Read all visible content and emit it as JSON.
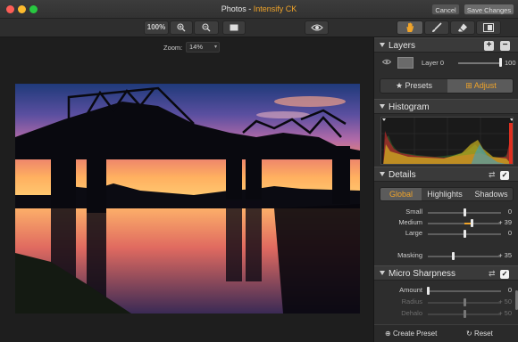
{
  "window": {
    "title_prefix": "Photos - ",
    "title_app": "Intensify CK",
    "cancel_label": "Cancel",
    "save_label": "Save Changes"
  },
  "toolbar": {
    "zoom_value": "100%",
    "icons": [
      "zoom-in-icon",
      "zoom-out-icon",
      "fit-to-screen-icon",
      "preview-eye-icon",
      "hand-tool-icon",
      "brush-tool-icon",
      "eraser-tool-icon",
      "mask-icon"
    ]
  },
  "canvas": {
    "zoom_label": "Zoom:",
    "zoom_value": "14%"
  },
  "panel": {
    "layers": {
      "title": "Layers",
      "layer_name": "Layer 0",
      "opacity_value": "100",
      "opacity_fraction": 1.0
    },
    "modes": {
      "presets_label": "Presets",
      "adjust_label": "Adjust",
      "active": "Adjust"
    },
    "histogram": {
      "title": "Histogram"
    },
    "details": {
      "title": "Details",
      "tabs": [
        "Global",
        "Highlights",
        "Shadows"
      ],
      "active_tab": "Global",
      "sliders": [
        {
          "label": "Small",
          "value": "0",
          "fraction": 0.5
        },
        {
          "label": "Medium",
          "value": "+ 39",
          "fraction": 0.6
        },
        {
          "label": "Large",
          "value": "0",
          "fraction": 0.5
        },
        {
          "label": "Masking",
          "value": "+ 35",
          "fraction": 0.35
        }
      ]
    },
    "micro_sharpness": {
      "title": "Micro Sharpness",
      "sliders": [
        {
          "label": "Amount",
          "value": "0",
          "fraction": 0.0
        },
        {
          "label": "Radius",
          "value": "+ 50",
          "fraction": 0.5
        },
        {
          "label": "Dehalo",
          "value": "+ 50",
          "fraction": 0.5
        }
      ]
    },
    "footer": {
      "create_preset_label": "Create Preset",
      "reset_label": "Reset"
    },
    "accent_color": "#f0a42a"
  }
}
